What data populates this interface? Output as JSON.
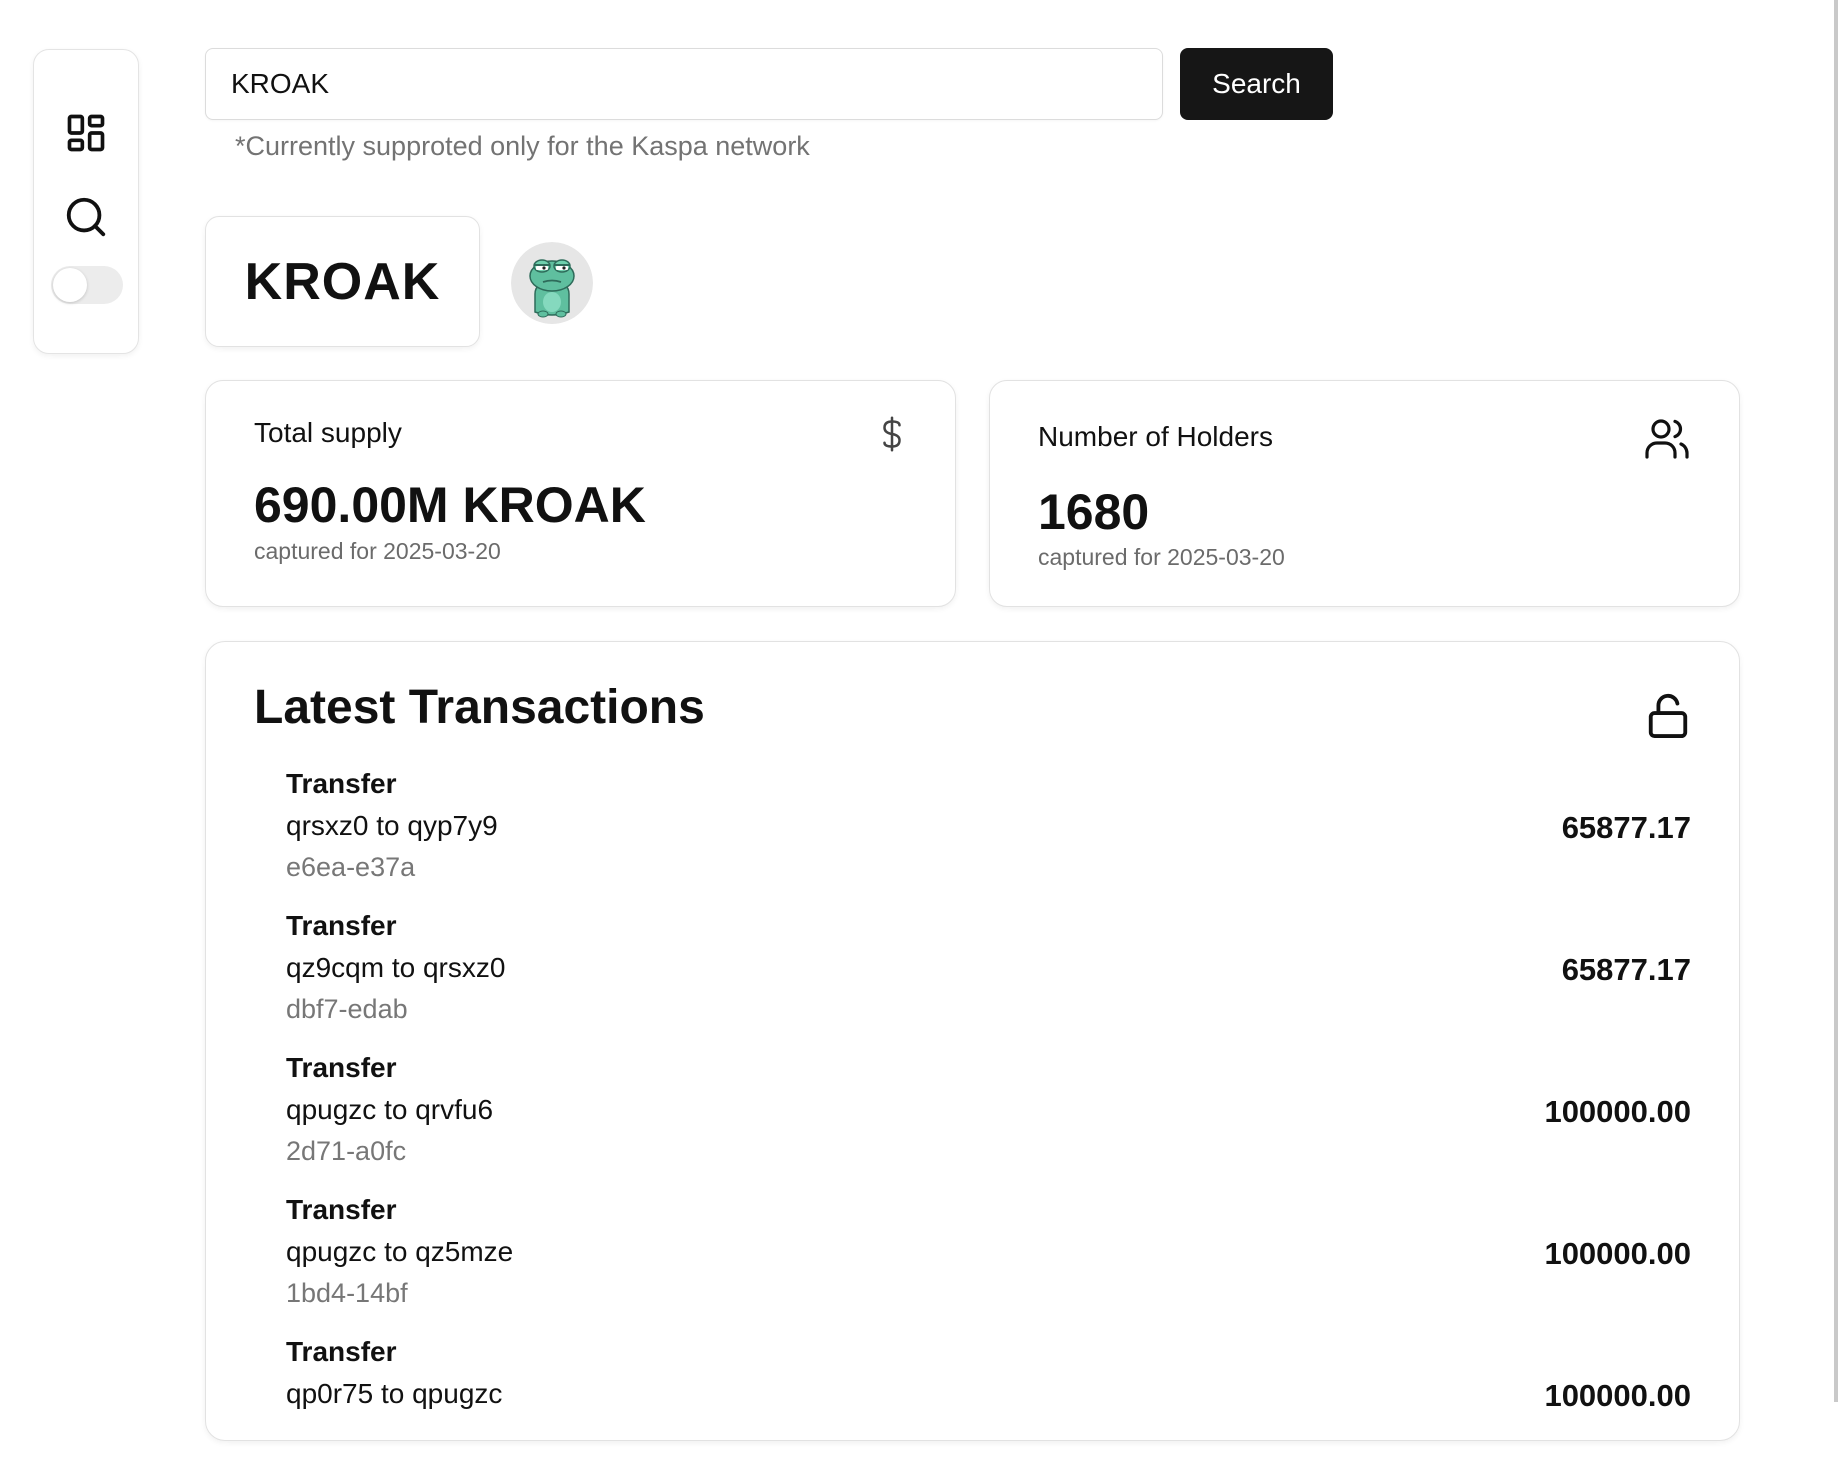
{
  "sidebar": {
    "items": [
      {
        "icon": "dashboard-icon"
      },
      {
        "icon": "search-icon"
      },
      {
        "icon": "theme-toggle"
      }
    ]
  },
  "search": {
    "value": "KROAK",
    "button_label": "Search",
    "note": "*Currently supproted only for the Kaspa network"
  },
  "token": {
    "name": "KROAK",
    "avatar_icon": "frog-avatar"
  },
  "stats": {
    "supply": {
      "label": "Total supply",
      "value": "690.00M KROAK",
      "caption": "captured for 2025-03-20",
      "icon": "dollar-icon"
    },
    "holders": {
      "label": "Number of Holders",
      "value": "1680",
      "caption": "captured for 2025-03-20",
      "icon": "users-icon"
    }
  },
  "transactions": {
    "title": "Latest Transactions",
    "icon": "unlock-icon",
    "items": [
      {
        "type": "Transfer",
        "route": "qrsxz0 to qyp7y9",
        "hash": "e6ea-e37a",
        "amount": "65877.17"
      },
      {
        "type": "Transfer",
        "route": "qz9cqm to qrsxz0",
        "hash": "dbf7-edab",
        "amount": "65877.17"
      },
      {
        "type": "Transfer",
        "route": "qpugzc to qrvfu6",
        "hash": "2d71-a0fc",
        "amount": "100000.00"
      },
      {
        "type": "Transfer",
        "route": "qpugzc to qz5mze",
        "hash": "1bd4-14bf",
        "amount": "100000.00"
      },
      {
        "type": "Transfer",
        "route": "qp0r75 to qpugzc",
        "hash": "",
        "amount": "100000.00"
      }
    ]
  },
  "colors": {
    "primary_button": "#161616",
    "muted_text": "#737373",
    "border": "#e2e2e2"
  }
}
